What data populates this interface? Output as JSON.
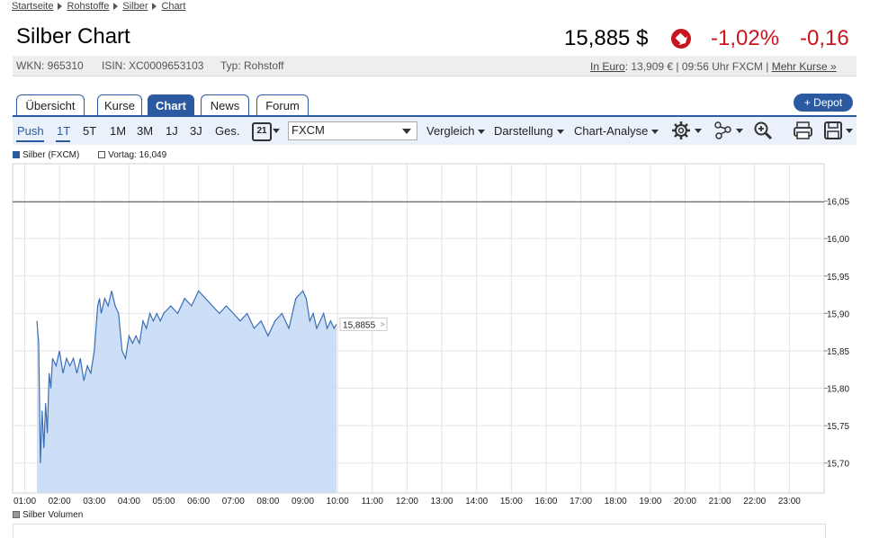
{
  "breadcrumb": [
    "Startseite",
    "Rohstoffe",
    "Silber",
    "Chart"
  ],
  "header": {
    "title": "Silber Chart",
    "price": "15,885 $",
    "change_pct": "-1,02%",
    "change_abs": "-0,16"
  },
  "info": {
    "wkn": "WKN: 965310",
    "isin": "ISIN: XC0009653103",
    "typ": "Typ: Rohstoff",
    "in_euro_link": "In Euro",
    "euro_text": ": 13,909 € | 09:56 Uhr FXCM |",
    "mehr_kurse": "Mehr Kurse »"
  },
  "tabs": [
    "Übersicht",
    "Kurse",
    "Chart",
    "News",
    "Forum"
  ],
  "depot_button": "+ Depot",
  "toolbar": {
    "ranges": [
      "Push",
      "1T",
      "5T",
      "1M",
      "3M",
      "1J",
      "3J",
      "Ges."
    ],
    "calendar_day": "21",
    "exchange": "FXCM",
    "vergleich": "Vergleich",
    "darstellung": "Darstellung",
    "chart_analyse": "Chart-Analyse"
  },
  "legend": {
    "series": "Silber (FXCM)",
    "vortag": "Vortag: 16,049"
  },
  "volume_legend": "Silber Volumen",
  "colors": {
    "accent": "#2c5aa0",
    "negative": "#c8141e",
    "area": "#c3d8f5",
    "line": "#3a6fb5"
  },
  "chart_data": {
    "type": "area",
    "x_ticks": [
      "01:00",
      "02:00",
      "03:00",
      "04:00",
      "05:00",
      "06:00",
      "07:00",
      "08:00",
      "09:00",
      "10:00",
      "11:00",
      "12:00",
      "13:00",
      "14:00",
      "15:00",
      "16:00",
      "17:00",
      "18:00",
      "19:00",
      "20:00",
      "21:00",
      "22:00",
      "23:00"
    ],
    "y_ticks": [
      "16,05",
      "16,00",
      "15,95",
      "15,90",
      "15,85",
      "15,80",
      "15,75",
      "15,70"
    ],
    "ylim": [
      15.66,
      16.1
    ],
    "xlim_hours": [
      0.65,
      24
    ],
    "reference_line": 16.049,
    "last_label": "15,8855",
    "series": [
      {
        "name": "Silber (FXCM)",
        "x": [
          1.35,
          1.4,
          1.45,
          1.5,
          1.55,
          1.6,
          1.65,
          1.7,
          1.75,
          1.8,
          1.9,
          2.0,
          2.1,
          2.2,
          2.3,
          2.4,
          2.5,
          2.6,
          2.7,
          2.8,
          2.9,
          3.0,
          3.05,
          3.1,
          3.15,
          3.2,
          3.3,
          3.4,
          3.5,
          3.6,
          3.7,
          3.8,
          3.9,
          4.0,
          4.1,
          4.2,
          4.3,
          4.4,
          4.5,
          4.6,
          4.7,
          4.8,
          4.9,
          5.0,
          5.2,
          5.4,
          5.6,
          5.8,
          6.0,
          6.2,
          6.4,
          6.6,
          6.8,
          7.0,
          7.2,
          7.4,
          7.6,
          7.8,
          8.0,
          8.2,
          8.4,
          8.6,
          8.8,
          9.0,
          9.1,
          9.2,
          9.3,
          9.4,
          9.5,
          9.6,
          9.7,
          9.8,
          9.9,
          9.97
        ],
        "y": [
          15.89,
          15.86,
          15.7,
          15.77,
          15.72,
          15.78,
          15.74,
          15.82,
          15.8,
          15.84,
          15.83,
          15.85,
          15.82,
          15.84,
          15.83,
          15.84,
          15.82,
          15.84,
          15.81,
          15.83,
          15.82,
          15.85,
          15.88,
          15.91,
          15.92,
          15.9,
          15.92,
          15.91,
          15.93,
          15.91,
          15.9,
          15.85,
          15.84,
          15.87,
          15.86,
          15.87,
          15.86,
          15.89,
          15.88,
          15.9,
          15.89,
          15.9,
          15.89,
          15.9,
          15.91,
          15.9,
          15.92,
          15.91,
          15.93,
          15.92,
          15.91,
          15.9,
          15.91,
          15.9,
          15.89,
          15.9,
          15.88,
          15.89,
          15.87,
          15.89,
          15.9,
          15.88,
          15.92,
          15.93,
          15.92,
          15.89,
          15.9,
          15.88,
          15.89,
          15.9,
          15.88,
          15.89,
          15.88,
          15.8855
        ]
      }
    ]
  }
}
